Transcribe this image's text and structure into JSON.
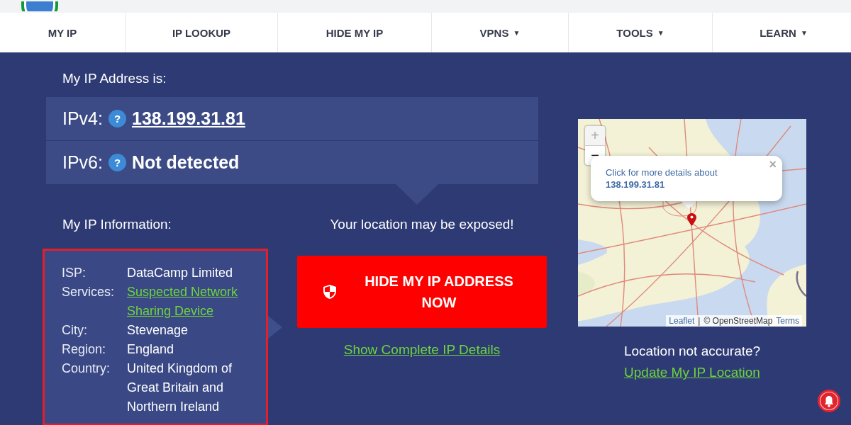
{
  "nav": {
    "tabs": [
      {
        "label": "MY IP"
      },
      {
        "label": "IP LOOKUP"
      },
      {
        "label": "HIDE MY IP"
      },
      {
        "label": "VPNS",
        "caret": "▼"
      },
      {
        "label": "TOOLS",
        "caret": "▼"
      },
      {
        "label": "LEARN",
        "caret": "▼"
      }
    ]
  },
  "ip_address": {
    "title": "My IP Address is:",
    "rows": [
      {
        "label": "IPv4:",
        "help": "?",
        "value": "138.199.31.81",
        "kind": "link"
      },
      {
        "label": "IPv6:",
        "help": "?",
        "value": "Not detected",
        "kind": "text"
      }
    ]
  },
  "ip_information": {
    "title": "My IP Information:",
    "rows": [
      {
        "label": "ISP:",
        "value": "DataCamp Limited",
        "kind": "text"
      },
      {
        "label": "Services:",
        "value": "Suspected Network Sharing Device",
        "kind": "link"
      },
      {
        "label": "City:",
        "value": "Stevenage",
        "kind": "text"
      },
      {
        "label": "Region:",
        "value": "England",
        "kind": "text"
      },
      {
        "label": "Country:",
        "value": "United Kingdom of Great Britain and Northern Ireland",
        "kind": "text"
      }
    ]
  },
  "warning": {
    "text": "Your location may be exposed!",
    "button": "HIDE MY IP ADDRESS NOW",
    "link": "Show Complete IP Details"
  },
  "map": {
    "zoom_in": "+",
    "zoom_out": "−",
    "popup": {
      "text": "Click for more details about",
      "ip": "138.199.31.81",
      "close": "×"
    },
    "attribution": {
      "leaflet": "Leaflet",
      "separator": "|",
      "osm": "© OpenStreetMap",
      "terms": "Terms"
    }
  },
  "location": {
    "question": "Location not accurate?",
    "link": "Update My IP Location"
  }
}
